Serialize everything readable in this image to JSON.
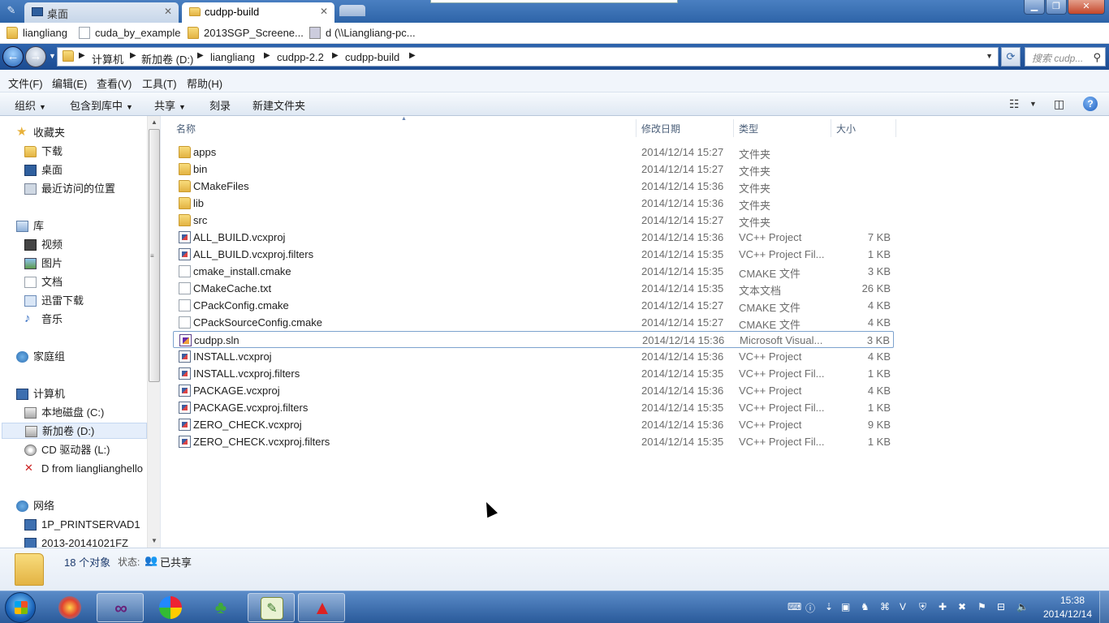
{
  "tabs": [
    {
      "label": "桌面",
      "active": false
    },
    {
      "label": "cudpp-build",
      "active": true
    }
  ],
  "bookmarks": [
    "liangliang",
    "cuda_by_example",
    "2013SGP_Screene...",
    "d (\\\\Liangliang-pc..."
  ],
  "address": {
    "crumbs": [
      "计算机",
      "新加卷 (D:)",
      "liangliang",
      "cudpp-2.2",
      "cudpp-build"
    ],
    "search_placeholder": "搜索 cudp..."
  },
  "menu": [
    "文件(F)",
    "编辑(E)",
    "查看(V)",
    "工具(T)",
    "帮助(H)"
  ],
  "commands": {
    "organize": "组织",
    "include_library": "包含到库中",
    "share": "共享",
    "burn": "刻录",
    "new_folder": "新建文件夹"
  },
  "nav": {
    "favorites": {
      "label": "收藏夹",
      "items": [
        "下载",
        "桌面",
        "最近访问的位置"
      ]
    },
    "libraries": {
      "label": "库",
      "items": [
        "视频",
        "图片",
        "文档",
        "迅雷下载",
        "音乐"
      ]
    },
    "homegroup": "家庭组",
    "computer": {
      "label": "计算机",
      "items": [
        "本地磁盘 (C:)",
        "新加卷 (D:)",
        "CD 驱动器 (L:)",
        "D from lianglianghello"
      ]
    },
    "network": {
      "label": "网络",
      "items": [
        "1P_PRINTSERVAD1",
        "2013-20141021FZ"
      ]
    }
  },
  "columns": {
    "name": "名称",
    "date": "修改日期",
    "type": "类型",
    "size": "大小"
  },
  "files": [
    {
      "name": "apps",
      "date": "2014/12/14 15:27",
      "type": "文件夹",
      "size": "",
      "icon": "folder-icon"
    },
    {
      "name": "bin",
      "date": "2014/12/14 15:27",
      "type": "文件夹",
      "size": "",
      "icon": "folder-icon"
    },
    {
      "name": "CMakeFiles",
      "date": "2014/12/14 15:36",
      "type": "文件夹",
      "size": "",
      "icon": "folder-icon"
    },
    {
      "name": "lib",
      "date": "2014/12/14 15:36",
      "type": "文件夹",
      "size": "",
      "icon": "folder-icon"
    },
    {
      "name": "src",
      "date": "2014/12/14 15:27",
      "type": "文件夹",
      "size": "",
      "icon": "folder-icon"
    },
    {
      "name": "ALL_BUILD.vcxproj",
      "date": "2014/12/14 15:36",
      "type": "VC++ Project",
      "size": "7 KB",
      "icon": "vcxproj-icon"
    },
    {
      "name": "ALL_BUILD.vcxproj.filters",
      "date": "2014/12/14 15:35",
      "type": "VC++ Project Fil...",
      "size": "1 KB",
      "icon": "vcxproj-icon"
    },
    {
      "name": "cmake_install.cmake",
      "date": "2014/12/14 15:35",
      "type": "CMAKE 文件",
      "size": "3 KB",
      "icon": "file-icon"
    },
    {
      "name": "CMakeCache.txt",
      "date": "2014/12/14 15:35",
      "type": "文本文档",
      "size": "26 KB",
      "icon": "file-icon"
    },
    {
      "name": "CPackConfig.cmake",
      "date": "2014/12/14 15:27",
      "type": "CMAKE 文件",
      "size": "4 KB",
      "icon": "file-icon"
    },
    {
      "name": "CPackSourceConfig.cmake",
      "date": "2014/12/14 15:27",
      "type": "CMAKE 文件",
      "size": "4 KB",
      "icon": "file-icon"
    },
    {
      "name": "cudpp.sln",
      "date": "2014/12/14 15:36",
      "type": "Microsoft Visual...",
      "size": "3 KB",
      "icon": "sln-icon"
    },
    {
      "name": "INSTALL.vcxproj",
      "date": "2014/12/14 15:36",
      "type": "VC++ Project",
      "size": "4 KB",
      "icon": "vcxproj-icon"
    },
    {
      "name": "INSTALL.vcxproj.filters",
      "date": "2014/12/14 15:35",
      "type": "VC++ Project Fil...",
      "size": "1 KB",
      "icon": "vcxproj-icon"
    },
    {
      "name": "PACKAGE.vcxproj",
      "date": "2014/12/14 15:36",
      "type": "VC++ Project",
      "size": "4 KB",
      "icon": "vcxproj-icon"
    },
    {
      "name": "PACKAGE.vcxproj.filters",
      "date": "2014/12/14 15:35",
      "type": "VC++ Project Fil...",
      "size": "1 KB",
      "icon": "vcxproj-icon"
    },
    {
      "name": "ZERO_CHECK.vcxproj",
      "date": "2014/12/14 15:36",
      "type": "VC++ Project",
      "size": "9 KB",
      "icon": "vcxproj-icon"
    },
    {
      "name": "ZERO_CHECK.vcxproj.filters",
      "date": "2014/12/14 15:35",
      "type": "VC++ Project Fil...",
      "size": "1 KB",
      "icon": "vcxproj-icon"
    }
  ],
  "status": {
    "count": "18 个对象",
    "state_label": "状态:",
    "state_value": "已共享"
  },
  "clock": {
    "time": "15:38",
    "date": "2014/12/14"
  }
}
